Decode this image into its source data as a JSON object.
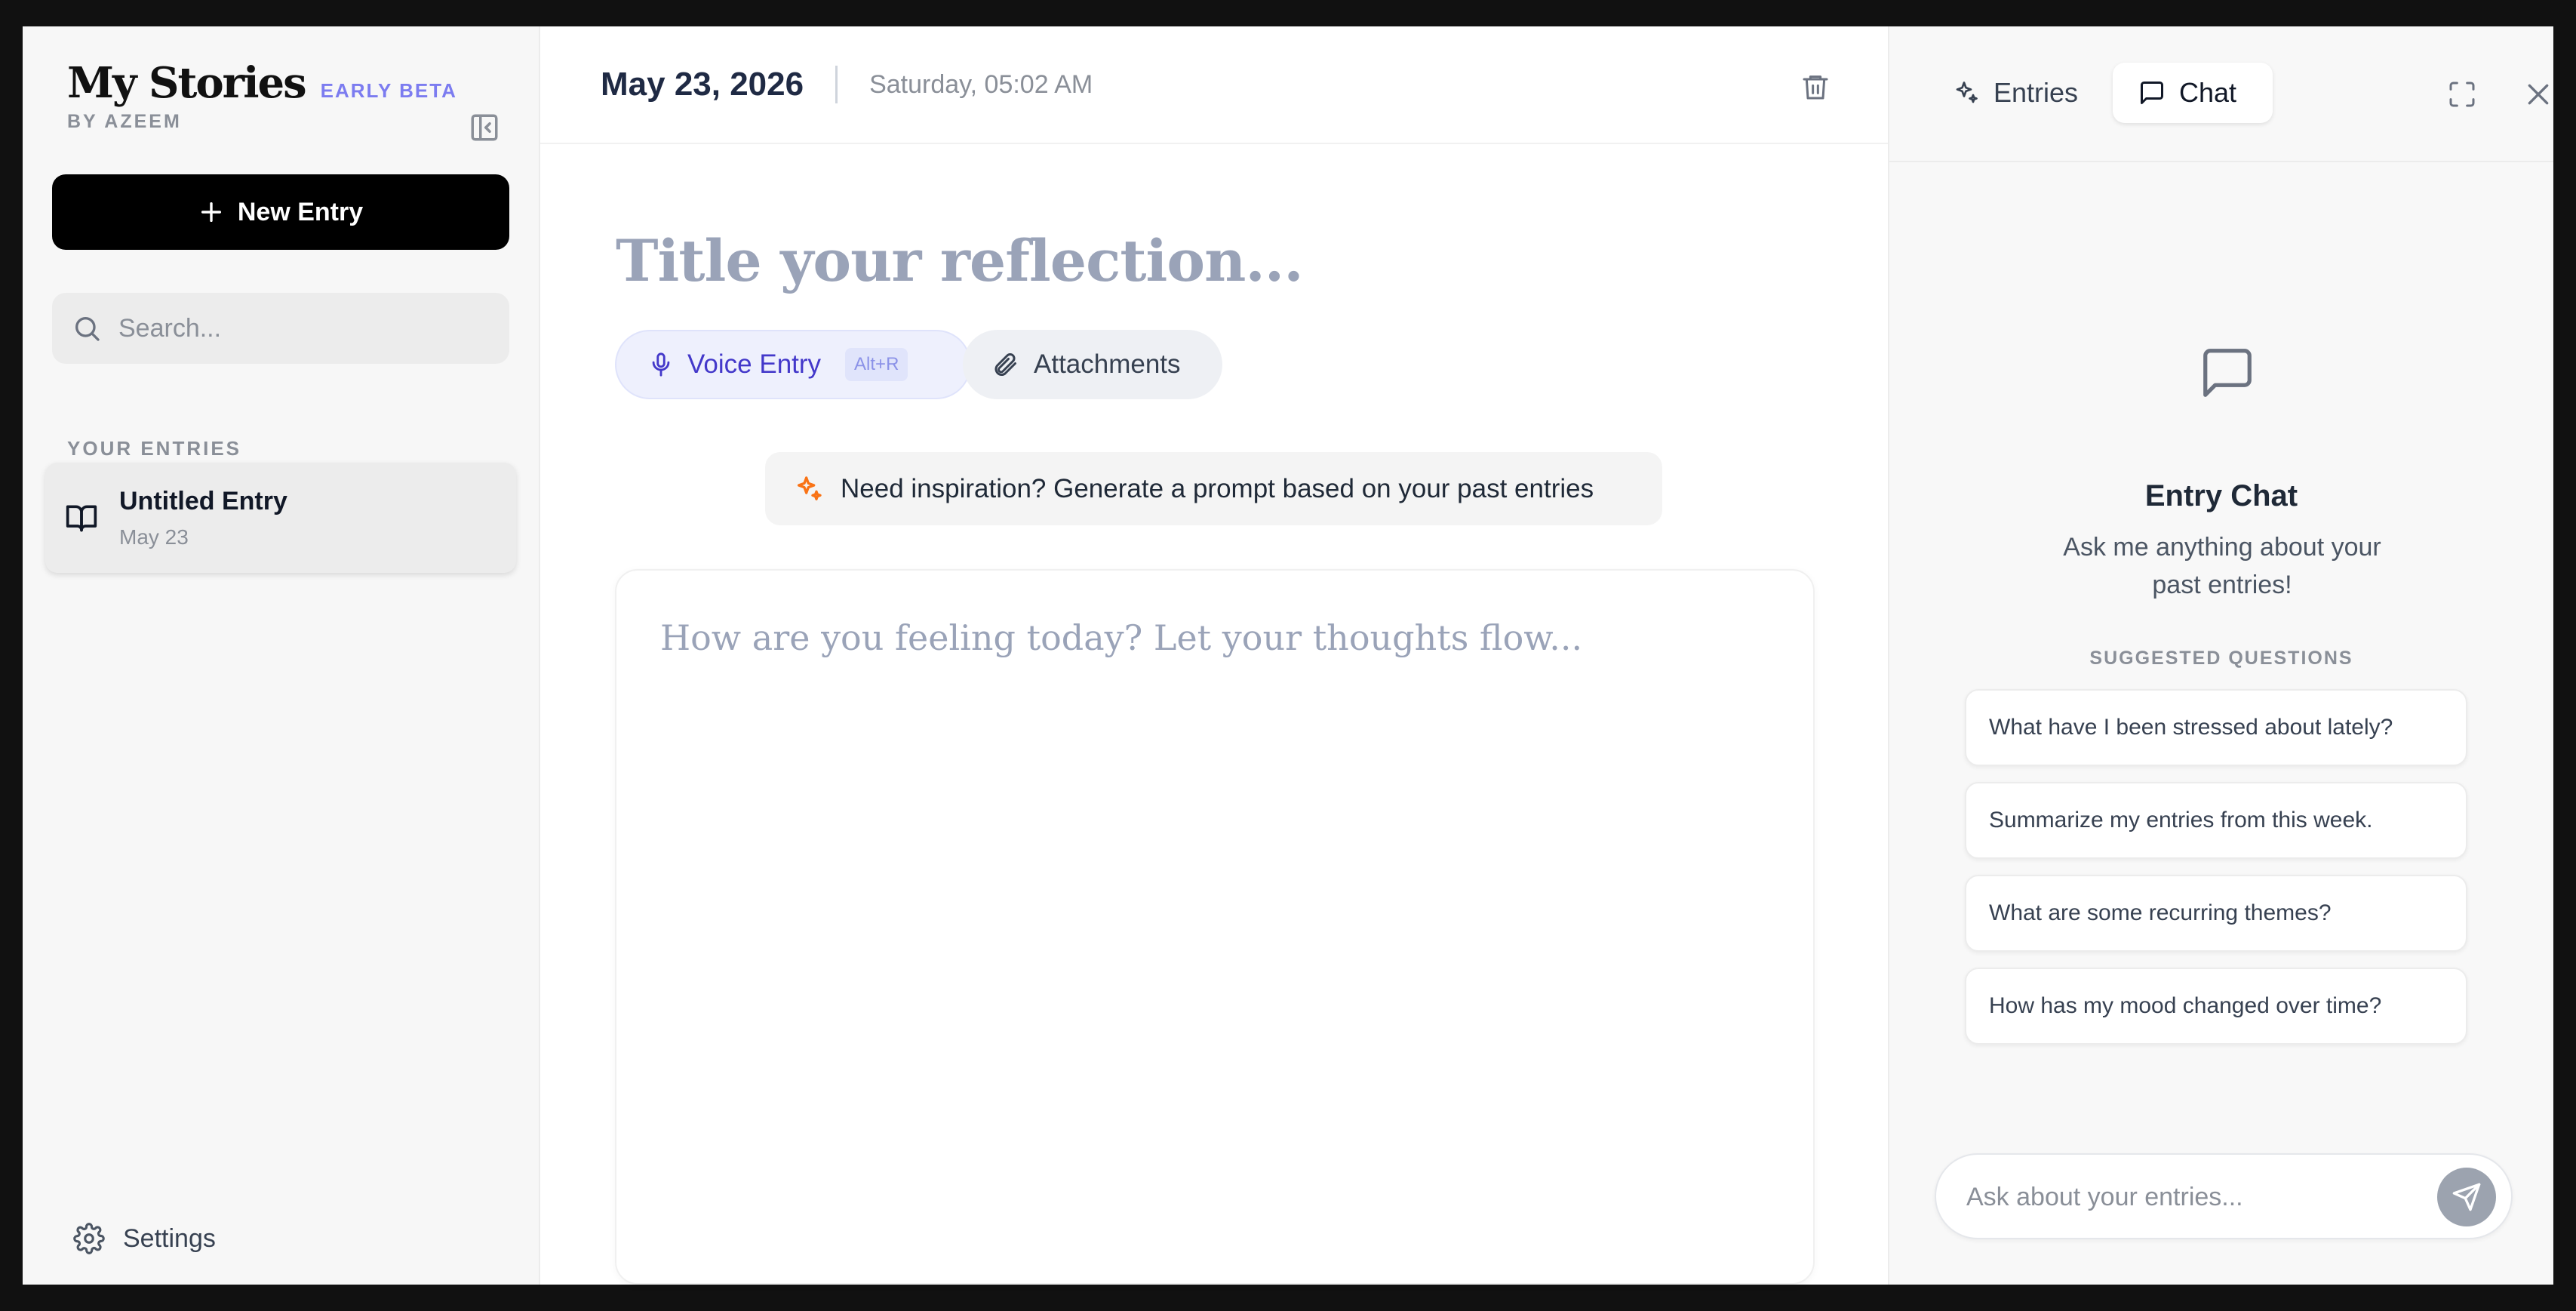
{
  "sidebar": {
    "brand_title": "My Stories",
    "brand_badge": "EARLY BETA",
    "brand_by": "BY AZEEM",
    "new_entry_label": "New Entry",
    "search_placeholder": "Search...",
    "section_label": "YOUR ENTRIES",
    "entries": [
      {
        "title": "Untitled Entry",
        "date": "May 23"
      }
    ],
    "settings_label": "Settings"
  },
  "main": {
    "date": "May 23, 2026",
    "day_time": "Saturday, 05:02 AM",
    "title_placeholder": "Title your reflection...",
    "voice_label": "Voice Entry",
    "voice_shortcut": "Alt+R",
    "attachments_label": "Attachments",
    "inspiration_label": "Need inspiration? Generate a prompt based on your past entries",
    "editor_placeholder": "How are you feeling today? Let your thoughts flow..."
  },
  "panel": {
    "tabs": [
      {
        "label": "Entries",
        "icon": "sparkles-icon"
      },
      {
        "label": "Chat",
        "icon": "chat-bubble-icon",
        "active": true
      }
    ],
    "empty_title": "Entry Chat",
    "empty_subtitle": "Ask me anything about your past entries!",
    "suggested_label": "SUGGESTED QUESTIONS",
    "suggestions": [
      "What have I been stressed about lately?",
      "Summarize my entries from this week.",
      "What are some recurring themes?",
      "How has my mood changed over time?"
    ],
    "input_placeholder": "Ask about your entries..."
  },
  "colors": {
    "accent": "#4338ca",
    "beta": "#7c7cf0",
    "inspire_icon": "#f97316",
    "title_placeholder": "#9aa3b8"
  }
}
